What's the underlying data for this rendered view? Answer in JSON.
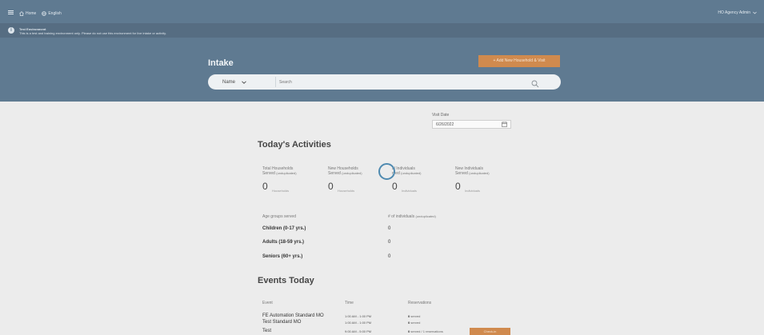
{
  "topbar": {
    "menu_icon": "menu-icon",
    "home_icon": "home-icon",
    "home_label": "Home",
    "language_icon": "globe-icon",
    "language_label": "English",
    "user_label": "HO Agency Admin",
    "user_dropdown_icon": "chevron-down-icon"
  },
  "banner": {
    "icon": "info-icon",
    "title": "Test Environment",
    "message": "This is a test and training environment only. Please do not use this environment for live intake or activity."
  },
  "intake": {
    "title": "Intake",
    "add_button": "+ Add New Household & Visit",
    "search_field": "Name",
    "search_placeholder": "Search",
    "search_icon": "search-icon"
  },
  "visit": {
    "label": "Visit Date",
    "value": "6/26/2022",
    "calendar_icon": "calendar-icon"
  },
  "activities": {
    "heading": "Today's Activities",
    "stats": [
      {
        "title": "Total Households",
        "subtitle_main": "Served",
        "subtitle_note": "(unduplicated)",
        "value": "0",
        "unit": "Households"
      },
      {
        "title": "New Households",
        "subtitle_main": "Served",
        "subtitle_note": "(unduplicated)",
        "value": "0",
        "unit": "Households"
      },
      {
        "title": "al Individuals",
        "subtitle_main": "rved",
        "subtitle_note": "(unduplicated)",
        "value": "0",
        "unit": "Individuals"
      },
      {
        "title": "New Individuals",
        "subtitle_main": "Served",
        "subtitle_note": "(unduplicated)",
        "value": "0",
        "unit": "Individuals"
      }
    ],
    "age_header": "Age groups served",
    "count_header_main": "# of individuals",
    "count_header_note": "(unduplicated)",
    "age_groups": [
      {
        "label": "Children (0-17 yrs.)",
        "value": "0"
      },
      {
        "label": "Adults (18-59 yrs.)",
        "value": "0"
      },
      {
        "label": "Seniors (60+ yrs.)",
        "value": "0"
      }
    ]
  },
  "events": {
    "heading": "Events Today",
    "col_event": "Event",
    "col_time": "Time",
    "col_reservations": "Reservations",
    "rows": [
      {
        "name": "FE Automation Standard MO",
        "time": "1:00 AM - 1:00 PM",
        "count": "0",
        "reservations": "served"
      },
      {
        "name": "Test Standard MO",
        "time": "1:00 AM - 1:00 PM",
        "count": "0",
        "reservations": "served"
      },
      {
        "name": "Test",
        "time": "9:00 AM - 5:00 PM",
        "count": "0",
        "reservations": "served / 1 reservations"
      }
    ],
    "checkin_label": "Check-in"
  }
}
